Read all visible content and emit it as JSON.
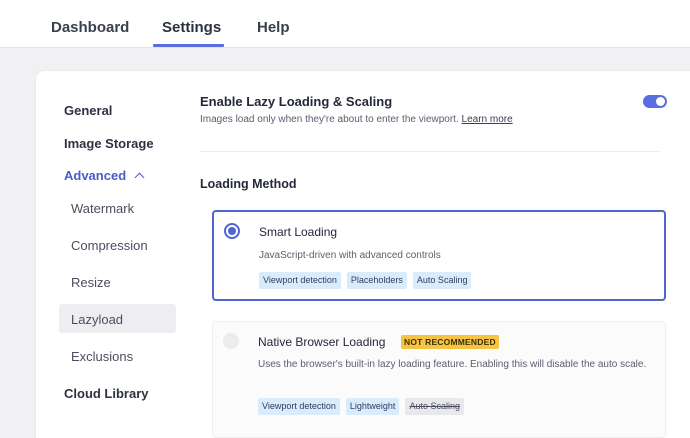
{
  "topnav": {
    "tabs": [
      {
        "label": "Dashboard"
      },
      {
        "label": "Settings"
      },
      {
        "label": "Help"
      }
    ],
    "active": "Settings"
  },
  "sidebar": {
    "items": [
      {
        "label": "General"
      },
      {
        "label": "Image Storage"
      },
      {
        "label": "Advanced"
      },
      {
        "label": "Watermark"
      },
      {
        "label": "Compression"
      },
      {
        "label": "Resize"
      },
      {
        "label": "Lazyload"
      },
      {
        "label": "Exclusions"
      },
      {
        "label": "Cloud Library"
      }
    ]
  },
  "lazy": {
    "title": "Enable Lazy Loading & Scaling",
    "desc": "Images load only when they're about to enter the viewport.",
    "link": "Learn more",
    "enabled": true
  },
  "method": {
    "title": "Loading Method",
    "smart": {
      "title": "Smart Loading",
      "desc": "JavaScript-driven with advanced controls",
      "tags": [
        "Viewport detection",
        "Placeholders",
        "Auto Scaling"
      ],
      "selected": true
    },
    "native": {
      "title": "Native Browser Loading",
      "badge": "NOT RECOMMENDED",
      "desc": "Uses the browser's built-in lazy loading feature. Enabling this will disable the auto scale.",
      "tags": [
        "Viewport detection",
        "Lightweight",
        "Auto Scaling"
      ],
      "selected": false
    }
  },
  "colors": {
    "accent": "#5064d4",
    "warning": "#f6c343",
    "tag_bg": "#d8ecfb"
  }
}
